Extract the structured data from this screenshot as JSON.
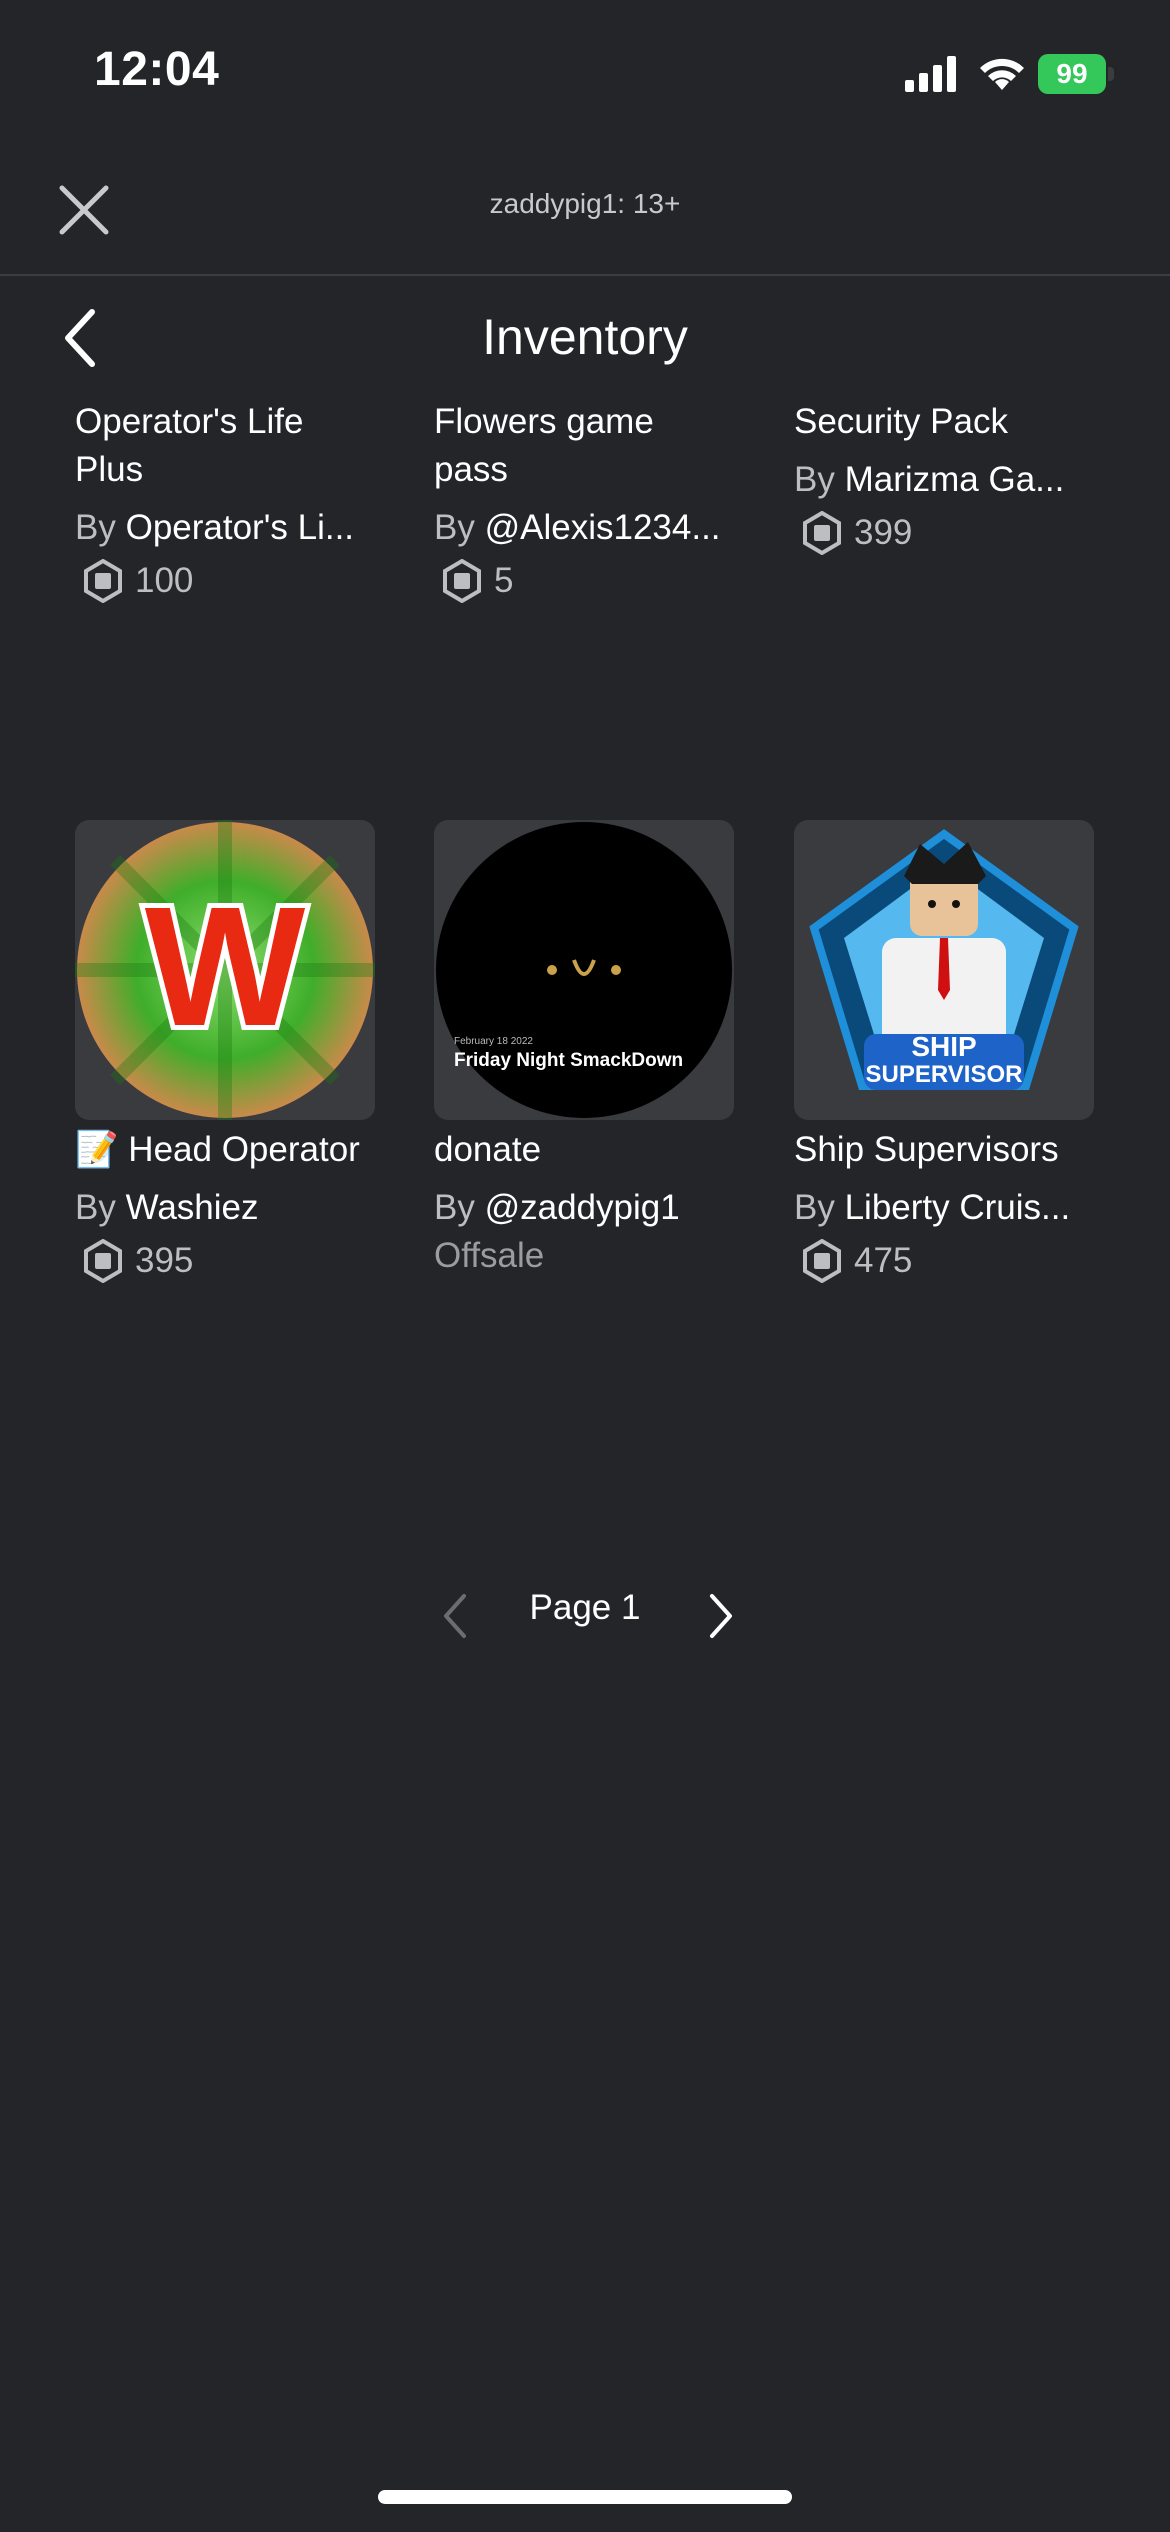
{
  "status": {
    "time": "12:04",
    "battery": "99"
  },
  "header": {
    "title": "zaddypig1: 13+"
  },
  "page": {
    "title": "Inventory"
  },
  "items": [
    {
      "name": "Operator's Life Plus",
      "by_label": "By",
      "creator": "Operator's Li...",
      "price": "100"
    },
    {
      "name": "Flowers game pass",
      "by_label": "By",
      "creator": "@Alexis1234...",
      "price": "5"
    },
    {
      "name": "Security Pack",
      "by_label": "By",
      "creator": "Marizma Ga...",
      "price": "399"
    },
    {
      "name": "📝 Head Operator",
      "by_label": "By",
      "creator": "Washiez",
      "price": "395",
      "thumb_letter": "W"
    },
    {
      "name": "donate",
      "by_label": "By",
      "creator": "@zaddypig1",
      "status": "Offsale",
      "thumb_caption": "Friday Night SmackDown",
      "thumb_date": "February 18 2022"
    },
    {
      "name": "Ship Supervisors",
      "by_label": "By",
      "creator": "Liberty Cruis...",
      "price": "475",
      "thumb_text_1": "SHIP",
      "thumb_text_2": "SUPERVISOR"
    }
  ],
  "pagination": {
    "label": "Page 1"
  },
  "colors": {
    "background": "#232529",
    "battery": "#34c759",
    "secondary_text": "#bdbec2"
  },
  "icons": [
    "close-icon",
    "back-chevron-icon",
    "robux-icon",
    "chevron-left-icon",
    "chevron-right-icon",
    "signal-icon",
    "wifi-icon",
    "battery-icon"
  ]
}
